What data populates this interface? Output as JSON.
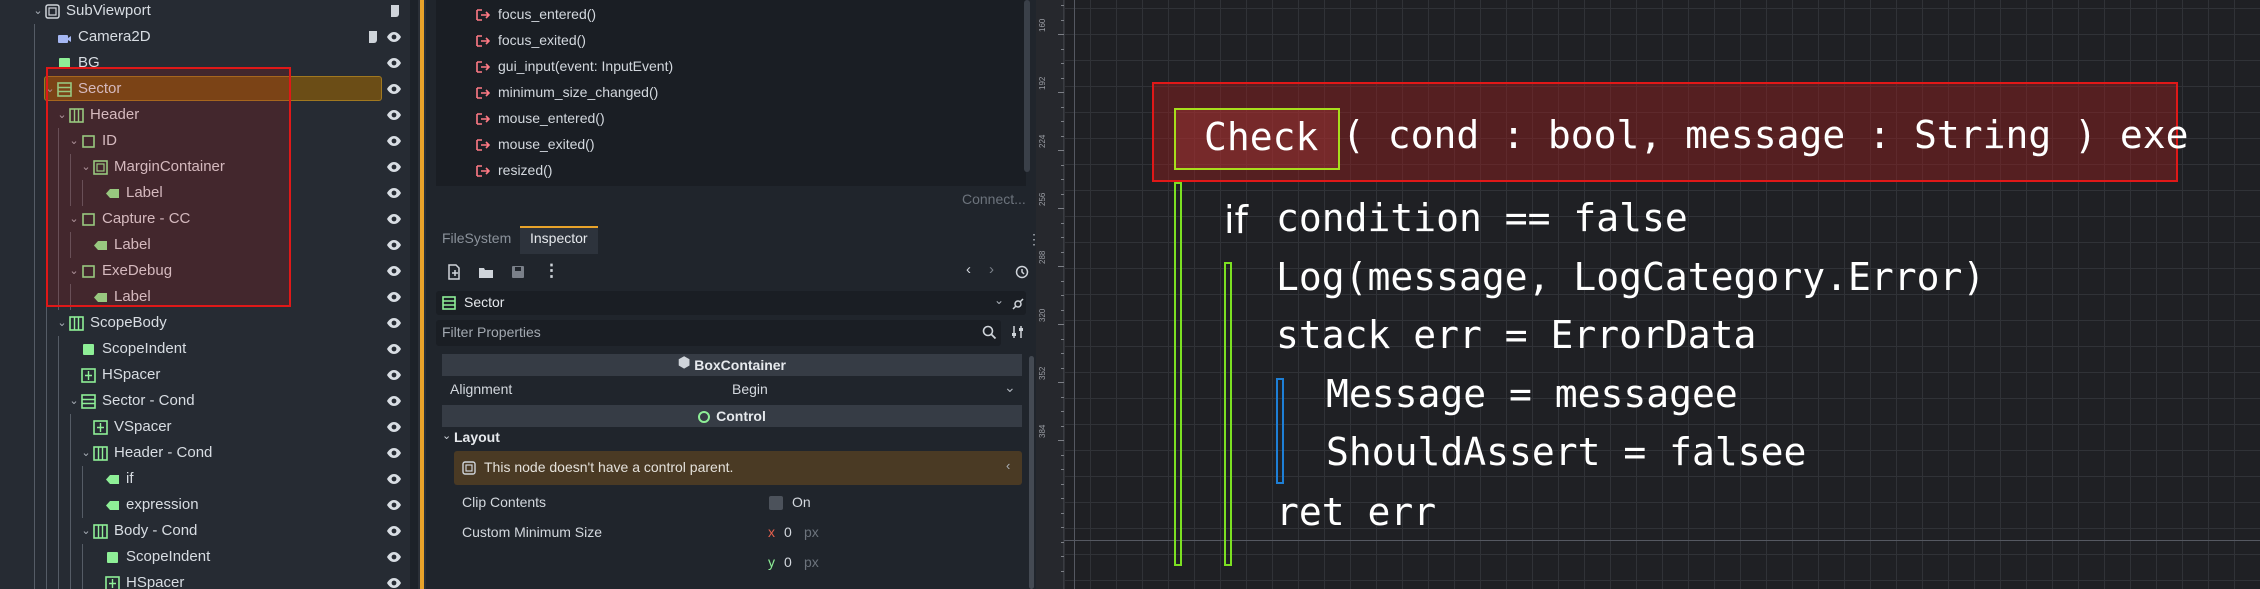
{
  "scene_tree": {
    "rows": [
      {
        "label": "SubViewport",
        "icon": "subviewport-icon"
      },
      {
        "label": "Camera2D",
        "icon": "camera2d-icon"
      },
      {
        "label": "BG",
        "icon": "colorrect-icon"
      },
      {
        "label": "Sector",
        "icon": "vboxcontainer-icon"
      },
      {
        "label": "Header",
        "icon": "hboxcontainer-icon"
      },
      {
        "label": "ID",
        "icon": "control-icon"
      },
      {
        "label": "MarginContainer",
        "icon": "margincontainer-icon"
      },
      {
        "label": "Label",
        "icon": "label-icon"
      },
      {
        "label": "Capture - CC",
        "icon": "control-icon"
      },
      {
        "label": "Label",
        "icon": "label-icon"
      },
      {
        "label": "ExeDebug",
        "icon": "control-icon"
      },
      {
        "label": "Label",
        "icon": "label-icon"
      },
      {
        "label": "ScopeBody",
        "icon": "hboxcontainer-icon"
      },
      {
        "label": "ScopeIndent",
        "icon": "colorrect-icon"
      },
      {
        "label": "HSpacer",
        "icon": "spacer-icon"
      },
      {
        "label": "Sector - Cond",
        "icon": "vboxcontainer-icon"
      },
      {
        "label": "VSpacer",
        "icon": "spacer-icon"
      },
      {
        "label": "Header - Cond",
        "icon": "hboxcontainer-icon"
      },
      {
        "label": "if",
        "icon": "label-icon"
      },
      {
        "label": "expression",
        "icon": "label-icon"
      },
      {
        "label": "Body - Cond",
        "icon": "hboxcontainer-icon"
      },
      {
        "label": "ScopeIndent",
        "icon": "colorrect-icon"
      },
      {
        "label": "HSpacer",
        "icon": "spacer-icon"
      }
    ]
  },
  "signals": {
    "items": [
      "focus_entered()",
      "focus_exited()",
      "gui_input(event: InputEvent)",
      "minimum_size_changed()",
      "mouse_entered()",
      "mouse_exited()",
      "resized()"
    ],
    "connect_label": "Connect..."
  },
  "dock": {
    "tabs": [
      "FileSystem",
      "Inspector"
    ]
  },
  "inspector": {
    "node_name": "Sector",
    "filter_placeholder": "Filter Properties",
    "section_boxcontainer": "BoxContainer",
    "alignment_label": "Alignment",
    "alignment_value": "Begin",
    "section_control": "Control",
    "layout_group": "Layout",
    "warning_text": "This node doesn't have a control parent.",
    "clip_contents_label": "Clip Contents",
    "clip_contents_value": "On",
    "custom_min_size_label": "Custom Minimum Size",
    "min_x_axis": "x",
    "min_x": "0",
    "min_y_axis": "y",
    "min_y": "0",
    "unit": "px"
  },
  "viewport": {
    "ruler_labels": [
      "160",
      "192",
      "224",
      "256",
      "288",
      "320",
      "352",
      "384"
    ],
    "code": {
      "check": "Check",
      "signature": "( cond : bool, message : String ) exe",
      "if_kw": "if",
      "if_expr": "condition == false",
      "log_line": "Log(message, LogCategory.Error)",
      "stack_line": "stack err = ErrorData",
      "message_line": "Message = messagee",
      "assert_line": "ShouldAssert = falsee",
      "ret_line": "ret err"
    }
  },
  "colors": {
    "accent_orange": "#e8a32a",
    "highlight_red": "#e01818",
    "highlight_green": "#a7dd1c",
    "bar_blue": "#1e7fd6",
    "node_green": "#8eef97",
    "signal_red": "#ff7a85"
  }
}
